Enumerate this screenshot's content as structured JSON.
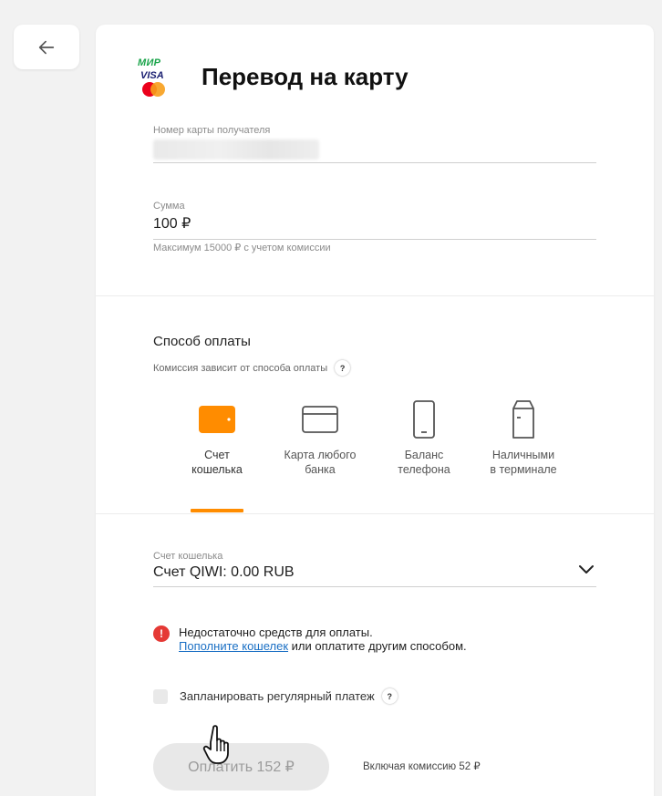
{
  "page": {
    "title": "Перевод на карту",
    "back_icon": "arrow-left-icon"
  },
  "card_logos": {
    "mir": "МИР",
    "visa": "VISA",
    "mastercard": "mastercard"
  },
  "recipient": {
    "label": "Номер карты получателя",
    "value": ""
  },
  "amount": {
    "label": "Сумма",
    "value": "100 ₽",
    "hint": "Максимум 15000 ₽ с учетом комиссии"
  },
  "payment": {
    "title": "Способ оплаты",
    "subtitle": "Комиссия зависит от способа оплаты",
    "help": "?",
    "methods": [
      {
        "label_line1": "Счет",
        "label_line2": "кошелька",
        "icon": "wallet-icon",
        "active": true
      },
      {
        "label_line1": "Карта любого",
        "label_line2": "банка",
        "icon": "bank-card-icon",
        "active": false
      },
      {
        "label_line1": "Баланс",
        "label_line2": "телефона",
        "icon": "phone-icon",
        "active": false
      },
      {
        "label_line1": "Наличными",
        "label_line2": "в терминале",
        "icon": "terminal-icon",
        "active": false
      }
    ],
    "accent_color": "#ff8c00"
  },
  "wallet": {
    "label": "Счет кошелька",
    "value": "Счет QIWI: 0.00 RUB"
  },
  "warning": {
    "line1": "Недостаточно средств для оплаты.",
    "link": "Пополните кошелек",
    "line2_rest": " или оплатите другим способом.",
    "color": "#e53935"
  },
  "schedule": {
    "label": "Запланировать регулярный платеж",
    "help": "?"
  },
  "pay": {
    "button": "Оплатить 152 ₽",
    "commission": "Включая комиссию 52 ₽"
  }
}
